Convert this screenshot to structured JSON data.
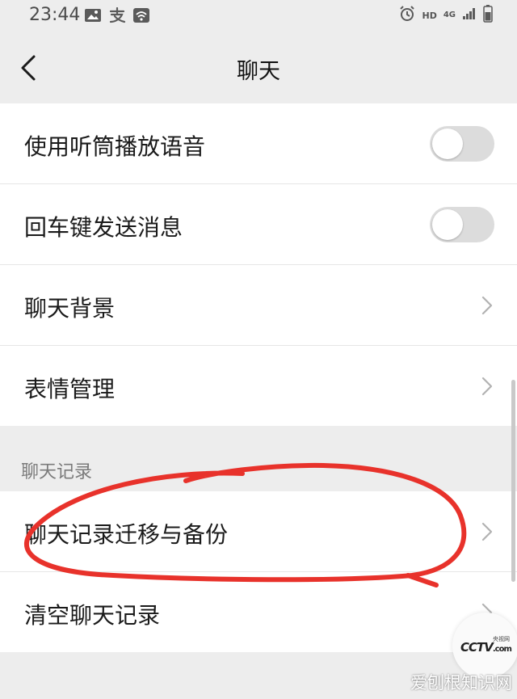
{
  "status_bar": {
    "time": "23:44",
    "hd_label": "HD",
    "network_label": "4G",
    "icons": [
      "image-icon",
      "alipay-icon",
      "wifi-icon",
      "alarm-icon",
      "signal-icon",
      "battery-icon"
    ]
  },
  "nav": {
    "title": "聊天",
    "back_icon": "chevron-left-icon"
  },
  "settings": {
    "items": [
      {
        "label": "使用听筒播放语音",
        "control": "toggle",
        "on": false
      },
      {
        "label": "回车键发送消息",
        "control": "toggle",
        "on": false
      },
      {
        "label": "聊天背景",
        "control": "chevron"
      },
      {
        "label": "表情管理",
        "control": "chevron"
      }
    ]
  },
  "chat_history": {
    "header": "聊天记录",
    "items": [
      {
        "label": "聊天记录迁移与备份",
        "control": "chevron"
      },
      {
        "label": "清空聊天记录",
        "control": "chevron"
      }
    ]
  },
  "watermarks": {
    "cctv_small": "央视网",
    "cctv_logo": "CCTV",
    "cctv_com": ".com",
    "site": "爱刨根知识网"
  },
  "colors": {
    "background": "#ededed",
    "annotation": "#e8322b",
    "toggle_off": "#dcdcdc"
  }
}
